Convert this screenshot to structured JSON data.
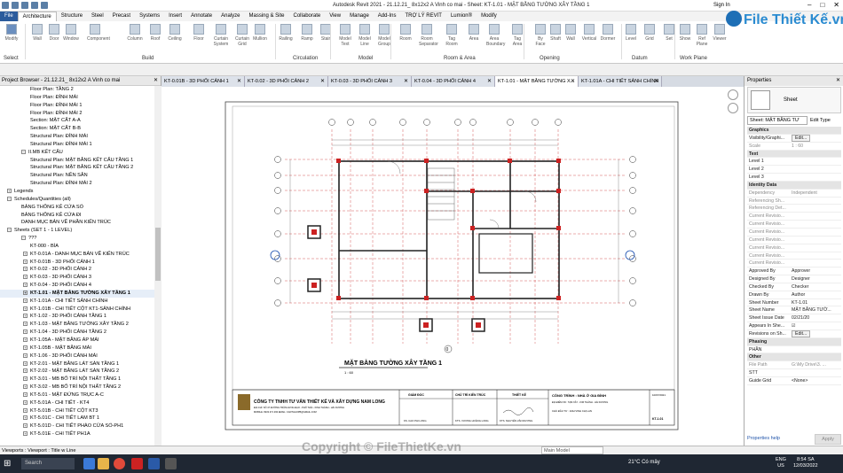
{
  "titlebar": {
    "title": "Autodesk Revit 2021 - 21.12.21_ 8x12x2 A Vinh co mai - Sheet: KT-1.01 - MẶT BẰNG TƯỜNG XÂY TẦNG 1",
    "signin": "Sign In"
  },
  "tabs": [
    "File",
    "Architecture",
    "Structure",
    "Steel",
    "Precast",
    "Systems",
    "Insert",
    "Annotate",
    "Analyze",
    "Massing & Site",
    "Collaborate",
    "View",
    "Manage",
    "Add-Ins",
    "TRỢ LÝ REVIT",
    "Lumion®",
    "Modify"
  ],
  "ribbon": {
    "buttons": [
      "Modify",
      "Wall",
      "Door",
      "Window",
      "Component",
      "Column",
      "Roof",
      "Ceiling",
      "Floor",
      "Curtain System",
      "Curtain Grid",
      "Mullion",
      "Railing",
      "Ramp",
      "Stair",
      "Model Text",
      "Model Line",
      "Model Group",
      "Room",
      "Room Separator",
      "Tag Room",
      "Area",
      "Area Boundary",
      "Tag Area",
      "By Face",
      "Shaft",
      "Wall",
      "Vertical",
      "Dormer",
      "Level",
      "Grid",
      "Set",
      "Show",
      "Ref Plane",
      "Viewer"
    ],
    "groups": [
      "Select",
      "Build",
      "Circulation",
      "Model",
      "Room & Area",
      "Opening",
      "Datum",
      "Work Plane"
    ]
  },
  "logo": {
    "text": "File Thiết Kế.vn"
  },
  "browser": {
    "title": "Project Browser - 21.12.21_ 8x12x2 A Vinh co mai",
    "items": [
      "Floor Plan: TẦNG 2",
      "Floor Plan: ĐỈNH MÁI",
      "Floor Plan: ĐỈNH MÁI 1",
      "Floor Plan: ĐỈNH MÁI 2",
      "Section: MẶT CẮT A-A",
      "Section: MẶT CẮT B-B",
      "Structural Plan: ĐỈNH MÁI",
      "Structural Plan: ĐỈNH MÁI 1",
      "II.MB KẾT CẤU",
      "Structural Plan: MẶT BẰNG KẾT CẤU TẦNG 1",
      "Structural Plan: MẶT BẰNG KẾT CẤU TẦNG 2",
      "Structural Plan: NỀN SÂN",
      "Structural Plan: ĐỈNH MÁI 2",
      "Legends",
      "Schedules/Quantities (all)",
      "BẢNG THỐNG KÊ CỬA SỔ",
      "BẢNG THỐNG KÊ CỬA ĐI",
      "DANH MỤC BẢN VẼ PHẦN KIẾN TRÚC",
      "Sheets (SET 1 - 1 LEVEL)",
      "???",
      "KT-000 - BÌA",
      "KT-0.01A - DANH MỤC BẢN VẼ KIẾN TRÚC",
      "KT-0.01B - 3D PHỐI CẢNH 1",
      "KT-0.02 - 3D PHỐI CẢNH 2",
      "KT-0.03 - 3D PHỐI CẢNH 3",
      "KT-0.04 - 3D PHỐI CẢNH 4",
      "KT-1.01 - MẶT BẰNG TƯỜNG XÂY TẦNG 1",
      "KT-1.01A - CHI TIẾT SẢNH CHÍNH",
      "KT-1.01B - CHI TIẾT CỘT KT1-SẢNH CHÍNH",
      "KT-1.02 - 3D PHỐI CẢNH TẦNG 1",
      "KT-1.03 - MẶT BẰNG TƯỜNG XÂY TẦNG 2",
      "KT-1.04 - 3D PHỐI CẢNH TẦNG 2",
      "KT-1.05A - MẶT BẰNG ÁP MÁI",
      "KT-1.05B - MẶT BẰNG MÁI",
      "KT-1.06 - 3D PHỐI CẢNH MÁI",
      "KT-2.01 - MẶT BẰNG LÁT SÀN TẦNG 1",
      "KT-2.02 - MẶT BẰNG LÁT SÀN TẦNG 2",
      "KT-3.01 - MB BỐ TRÍ NỘI THẤT TẦNG 1",
      "KT-3.02 - MB BỐ TRÍ NỘI THẤT TẦNG 2",
      "KT-5.01 - MẶT ĐỨNG TRỤC A-C",
      "KT-5.01A - CHI TIẾT - KT4",
      "KT-5.01B - CHI TIẾT CỘT KT3",
      "KT-5.01C - CHI TIẾT LAM BT 1",
      "KT-5.01D - CHI TIẾT PHÀO CỬA SỔ-PH1",
      "KT-5.01E - CHI TIẾT PH1A"
    ]
  },
  "viewtabs": [
    "KT-0.01B - 3D PHỐI CẢNH 1",
    "KT-0.02 - 3D PHỐI CẢNH 2",
    "KT-0.03 - 3D PHỐI CẢNH 3",
    "KT-0.04 - 3D PHỐI CẢNH 4",
    "KT-1.01 - MẶT BẰNG TƯỜNG X...",
    "KT-1.01A - CHI TIẾT SẢNH CHÍNH"
  ],
  "sheet": {
    "view_title": "MẶT BẰNG TƯỜNG XÂY TẦNG 1",
    "scale": "1 : 60",
    "company": "CÔNG TY TNHH TƯ VẤN THIẾT KẾ VÀ XÂY DỰNG NAM LONG",
    "address": "ĐỊA CHỈ: SỐ 47 ĐƯỜNG TRẦN HƯNG ĐẠO - PHỐ THÁI - KINH THÀNH - HẢI DƯƠNG",
    "contact": "MOBILE: 0933 471 293  EMAIL: CADTHAOPB@GMAIL.COM",
    "giam_doc": "GIÁM ĐỐC",
    "chu_tri": "CHỦ TRÌ KIẾN TRÚC",
    "thiet_ke": "THIẾT KẾ",
    "gd_name": "KS. CAO PHI LONG",
    "ct_name": "KTS. VƯƠNG HOÀNG LONG",
    "tk_name": "KTS. NGUYỄN VĂN DƯƠNG",
    "project": "CÔNG TRÌNH : NHÀ Ở GIA ĐÌNH",
    "location": "ĐỊA ĐIỂM XD : TẠM XÂY - KIM THÀNH - HẢI DƯƠNG",
    "owner": "CHỦ ĐẦU TƯ : ANH VINH CHỊ LAN",
    "date": "10/07/2021",
    "sheet_no": "KT-1.01",
    "grid_bottom_label": "0"
  },
  "properties": {
    "title": "Properties",
    "type": "Sheet",
    "selector": "Sheet: MẶT BẰNG TƯ",
    "edit_type": "Edit Type",
    "rows": [
      {
        "k": "Graphics",
        "sect": true
      },
      {
        "k": "Visibility/Graphi...",
        "v": "Edit...",
        "btn": true
      },
      {
        "k": "Scale",
        "v": "1 : 60",
        "grey": true
      },
      {
        "k": "Text",
        "sect": true
      },
      {
        "k": "Level 1",
        "v": ""
      },
      {
        "k": "Level 2",
        "v": ""
      },
      {
        "k": "Level 3",
        "v": ""
      },
      {
        "k": "Identity Data",
        "sect": true
      },
      {
        "k": "Dependency",
        "v": "Independent",
        "grey": true
      },
      {
        "k": "Referencing Sh...",
        "v": "",
        "grey": true
      },
      {
        "k": "Referencing Det...",
        "v": "",
        "grey": true
      },
      {
        "k": "Current Revisio...",
        "v": "",
        "grey": true
      },
      {
        "k": "Current Revisio...",
        "v": "",
        "grey": true
      },
      {
        "k": "Current Revisio...",
        "v": "",
        "grey": true
      },
      {
        "k": "Current Revisio...",
        "v": "",
        "grey": true
      },
      {
        "k": "Current Revisio...",
        "v": "",
        "grey": true
      },
      {
        "k": "Current Revisio...",
        "v": "",
        "grey": true
      },
      {
        "k": "Current Revisio...",
        "v": "",
        "grey": true
      },
      {
        "k": "Approved By",
        "v": "Approver"
      },
      {
        "k": "Designed By",
        "v": "Designer"
      },
      {
        "k": "Checked By",
        "v": "Checker"
      },
      {
        "k": "Drawn By",
        "v": "Author"
      },
      {
        "k": "Sheet Number",
        "v": "KT-1.01"
      },
      {
        "k": "Sheet Name",
        "v": "MẶT BẰNG TƯỜ..."
      },
      {
        "k": "Sheet Issue Date",
        "v": "02/21/20"
      },
      {
        "k": "Appears In She...",
        "v": "☑"
      },
      {
        "k": "Revisions on Sh...",
        "v": "Edit...",
        "btn": true
      },
      {
        "k": "Phasing",
        "sect": true
      },
      {
        "k": "PHẦN",
        "v": ""
      },
      {
        "k": "Other",
        "sect": true
      },
      {
        "k": "File Path",
        "v": "G:\\My Drive\\3. ...",
        "grey": true
      },
      {
        "k": "STT",
        "v": ""
      },
      {
        "k": "Guide Grid",
        "v": "<None>"
      }
    ],
    "help": "Properties help",
    "apply": "Apply"
  },
  "status": {
    "text": "Viewports : Viewport : Title w Line",
    "model": "Main Model"
  },
  "taskbar": {
    "search": "Search",
    "weather": "21°C  Có mây",
    "lang": "ENG\nUS",
    "time": "8:54 SA",
    "date": "12/03/2022"
  },
  "watermark": "Copyright © FileThietKe.vn"
}
